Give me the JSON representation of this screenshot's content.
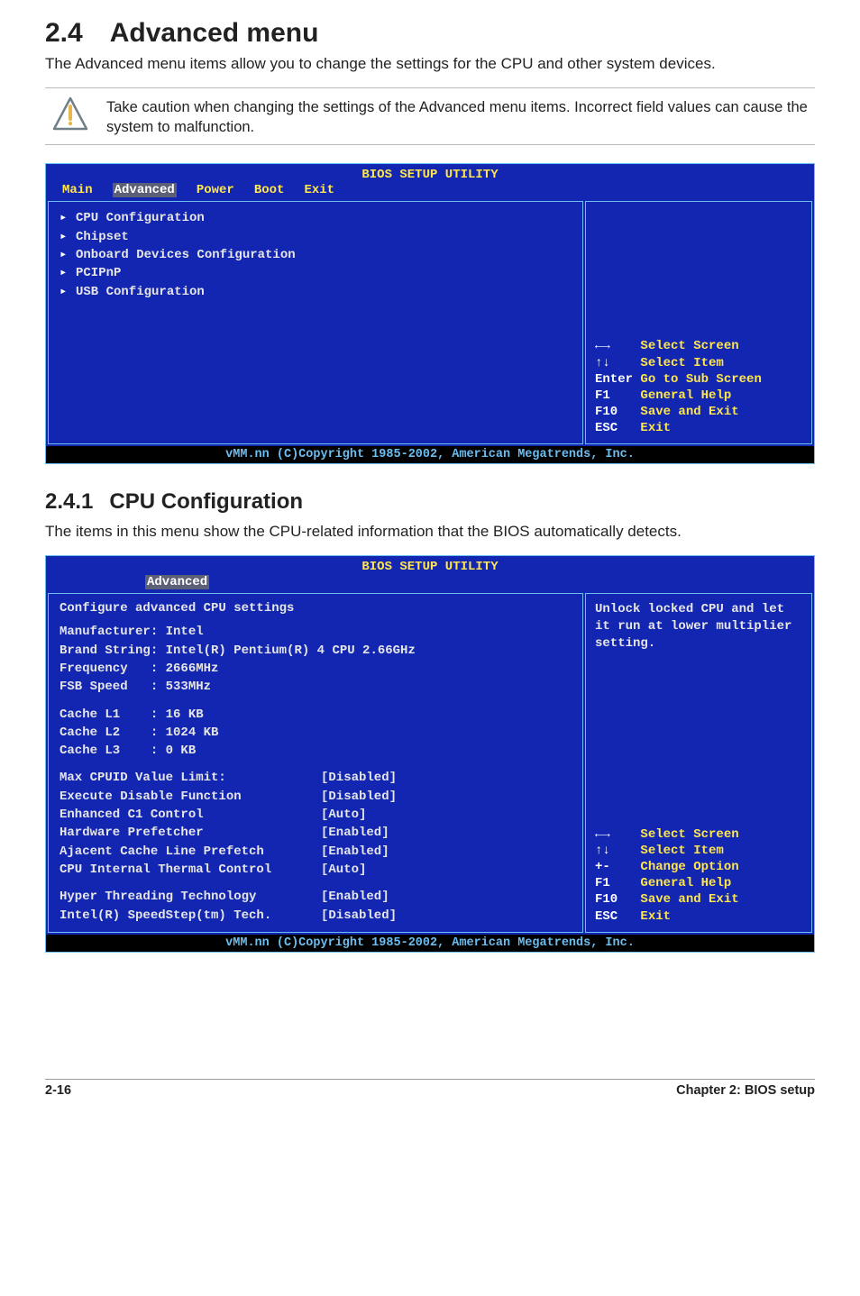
{
  "section": {
    "number": "2.4",
    "title": "Advanced menu"
  },
  "intro": "The Advanced menu items allow you to change the settings for the CPU and other system devices.",
  "caution": "Take caution when changing the settings of the Advanced menu items. Incorrect field values can cause the system to malfunction.",
  "bios1": {
    "title": "BIOS SETUP UTILITY",
    "tabs": [
      "Main",
      "Advanced",
      "Power",
      "Boot",
      "Exit"
    ],
    "activeTab": "Advanced",
    "menu": [
      "CPU Configuration",
      "Chipset",
      "Onboard Devices Configuration",
      "PCIPnP",
      "USB Configuration"
    ],
    "nav": [
      {
        "key": "←→",
        "label": "Select Screen"
      },
      {
        "key": "↑↓",
        "label": "Select Item"
      },
      {
        "key": "Enter",
        "label": "Go to Sub Screen"
      },
      {
        "key": "F1",
        "label": "General Help"
      },
      {
        "key": "F10",
        "label": "Save and Exit"
      },
      {
        "key": "ESC",
        "label": "Exit"
      }
    ],
    "footer": "vMM.nn (C)Copyright 1985-2002, American Megatrends, Inc."
  },
  "subsection": {
    "number": "2.4.1",
    "title": "CPU Configuration"
  },
  "subintro": "The items in this menu show the CPU-related information that the BIOS automatically detects.",
  "bios2": {
    "title": "BIOS SETUP UTILITY",
    "activeTab": "Advanced",
    "heading": "Configure advanced CPU settings",
    "info": [
      "Manufacturer: Intel",
      "Brand String: Intel(R) Pentium(R) 4 CPU 2.66GHz",
      "Frequency   : 2666MHz",
      "FSB Speed   : 533MHz"
    ],
    "cache": [
      "Cache L1    : 16 KB",
      "Cache L2    : 1024 KB",
      "Cache L3    : 0 KB"
    ],
    "settings1": [
      {
        "name": "Max CPUID Value Limit:",
        "value": "[Disabled]"
      },
      {
        "name": "Execute Disable Function",
        "value": "[Disabled]"
      },
      {
        "name": "Enhanced C1 Control",
        "value": "[Auto]"
      },
      {
        "name": "Hardware Prefetcher",
        "value": "[Enabled]"
      },
      {
        "name": "Ajacent Cache Line Prefetch",
        "value": "[Enabled]"
      },
      {
        "name": "CPU Internal Thermal Control",
        "value": "[Auto]"
      }
    ],
    "settings2": [
      {
        "name": "Hyper Threading Technology",
        "value": "[Enabled]"
      },
      {
        "name": "Intel(R) SpeedStep(tm) Tech.",
        "value": "[Disabled]"
      }
    ],
    "help": "Unlock locked CPU and let it run at lower multiplier setting.",
    "nav": [
      {
        "key": "←→",
        "label": "Select Screen"
      },
      {
        "key": "↑↓",
        "label": "Select Item"
      },
      {
        "key": "+-",
        "label": "Change Option"
      },
      {
        "key": "F1",
        "label": "General Help"
      },
      {
        "key": "F10",
        "label": "Save and Exit"
      },
      {
        "key": "ESC",
        "label": "Exit"
      }
    ],
    "footer": "vMM.nn (C)Copyright 1985-2002, American Megatrends, Inc."
  },
  "pageFooter": {
    "left": "2-16",
    "right": "Chapter 2: BIOS setup"
  }
}
